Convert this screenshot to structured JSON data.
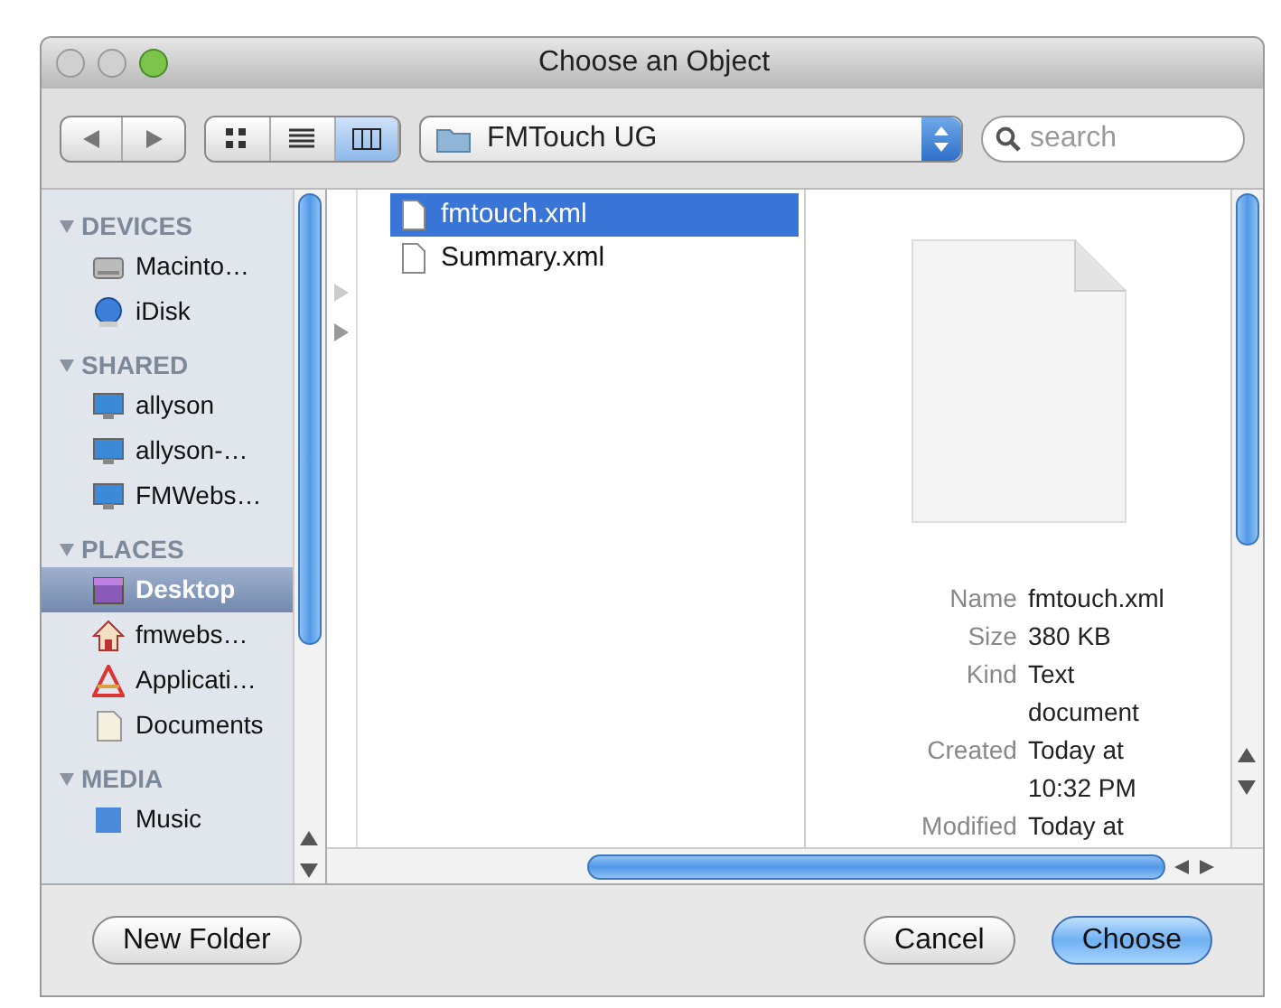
{
  "window": {
    "title": "Choose an Object"
  },
  "toolbar": {
    "view_modes": [
      {
        "kind": "icons",
        "selected": false
      },
      {
        "kind": "list",
        "selected": false
      },
      {
        "kind": "columns",
        "selected": true
      }
    ],
    "location": "FMTouch UG",
    "search": {
      "placeholder": "search"
    }
  },
  "sidebar": {
    "sections": [
      {
        "title": "DEVICES",
        "items": [
          {
            "label": "Macinto…",
            "kind": "disk",
            "selected": false
          },
          {
            "label": "iDisk",
            "kind": "idisk",
            "selected": false
          }
        ]
      },
      {
        "title": "SHARED",
        "items": [
          {
            "label": "allyson",
            "kind": "computer",
            "selected": false
          },
          {
            "label": "allyson-…",
            "kind": "computer",
            "selected": false
          },
          {
            "label": "FMWebs…",
            "kind": "computer",
            "selected": false
          }
        ]
      },
      {
        "title": "PLACES",
        "items": [
          {
            "label": "Desktop",
            "kind": "desktop",
            "selected": true
          },
          {
            "label": "fmwebs…",
            "kind": "home",
            "selected": false
          },
          {
            "label": "Applicati…",
            "kind": "apps",
            "selected": false
          },
          {
            "label": "Documents",
            "kind": "docs",
            "selected": false
          }
        ]
      },
      {
        "title": "MEDIA",
        "items": [
          {
            "label": "Music",
            "kind": "music",
            "selected": false
          }
        ]
      }
    ]
  },
  "files": [
    {
      "name": "fmtouch.xml",
      "selected": true
    },
    {
      "name": "Summary.xml",
      "selected": false
    }
  ],
  "preview": {
    "info": [
      {
        "label": "Name",
        "value": "fmtouch.xml"
      },
      {
        "label": "Size",
        "value": "380 KB"
      },
      {
        "label": "Kind",
        "value": "Text document"
      },
      {
        "label": "Created",
        "value": "Today at 10:32 PM"
      },
      {
        "label": "Modified",
        "value": "Today at"
      }
    ]
  },
  "buttons": [
    {
      "label": "New Folder",
      "kind": "plain"
    },
    {
      "label": "Cancel",
      "kind": "plain"
    },
    {
      "label": "Choose",
      "kind": "default"
    }
  ]
}
